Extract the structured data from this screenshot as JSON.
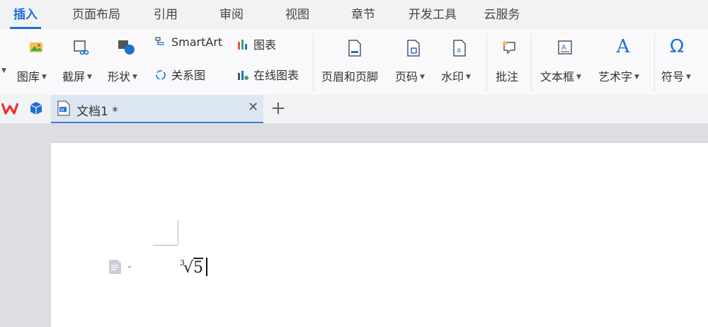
{
  "menu_tabs": [
    {
      "label": "插入",
      "active": true
    },
    {
      "label": "页面布局"
    },
    {
      "label": "引用"
    },
    {
      "label": "审阅"
    },
    {
      "label": "视图"
    },
    {
      "label": "章节"
    },
    {
      "label": "开发工具"
    },
    {
      "label": "云服务"
    }
  ],
  "ribbon": {
    "gallery": {
      "label": "图库",
      "icon": "gallery-icon"
    },
    "screenshot": {
      "label": "截屏",
      "icon": "screenshot-icon"
    },
    "shapes": {
      "label": "形状",
      "icon": "shapes-icon"
    },
    "smartart": {
      "label": "SmartArt",
      "icon": "smartart-icon"
    },
    "relation": {
      "label": "关系图",
      "icon": "relation-diagram-icon"
    },
    "chart": {
      "label": "图表",
      "icon": "chart-icon"
    },
    "online_chart": {
      "label": "在线图表",
      "icon": "online-chart-icon"
    },
    "header_footer": {
      "label": "页眉和页脚",
      "icon": "header-footer-icon"
    },
    "page_number": {
      "label": "页码",
      "icon": "page-number-icon"
    },
    "watermark": {
      "label": "水印",
      "icon": "watermark-icon"
    },
    "comment": {
      "label": "批注",
      "icon": "comment-icon"
    },
    "textbox": {
      "label": "文本框",
      "icon": "textbox-icon"
    },
    "wordart": {
      "label": "艺术字",
      "icon": "wordart-icon"
    },
    "symbol": {
      "label": "符号",
      "icon": "symbol-icon"
    }
  },
  "document": {
    "tab_title": "文档1 *",
    "formula": {
      "index": "3",
      "radicand": "5"
    }
  },
  "colors": {
    "accent": "#1e6fd8",
    "wps_red": "#e8312f",
    "tab_active_bg": "#dde7f3"
  }
}
